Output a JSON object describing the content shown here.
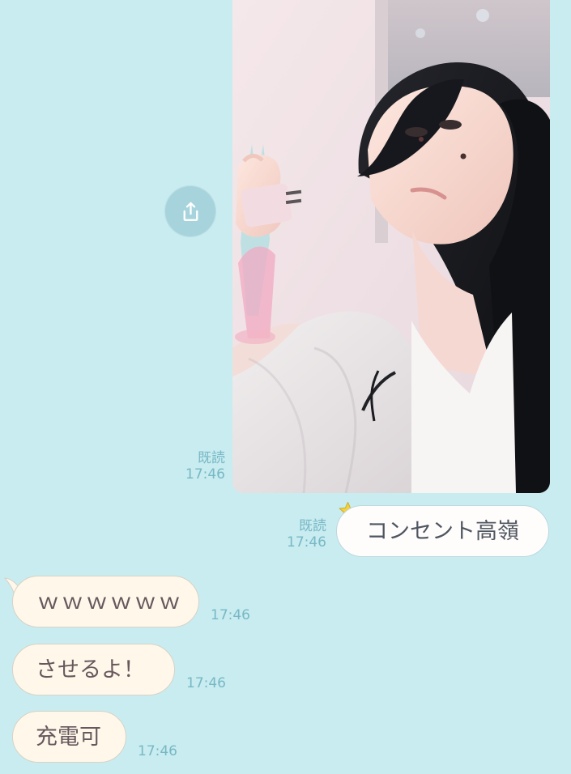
{
  "conversation": {
    "photo_message": {
      "read_status": "既読",
      "time": "17:46"
    },
    "share_button": {
      "icon": "share-icon"
    },
    "sent_message": {
      "read_status": "既読",
      "time": "17:46",
      "text": "コンセント高嶺",
      "icon": "star-icon"
    },
    "received_messages": [
      {
        "text": "ｗｗｗｗｗｗ",
        "time": "17:46"
      },
      {
        "text": "させるよ！",
        "time": "17:46"
      },
      {
        "text": "充電可",
        "time": "17:46"
      }
    ]
  },
  "colors": {
    "background": "#c8ecf0",
    "meta_text": "#78b8c5",
    "share_button": "#a7d4dc",
    "sent_bubble": "#fffdfc",
    "received_bubble": "#fff8ea",
    "accent_star": "#f4d23f"
  }
}
